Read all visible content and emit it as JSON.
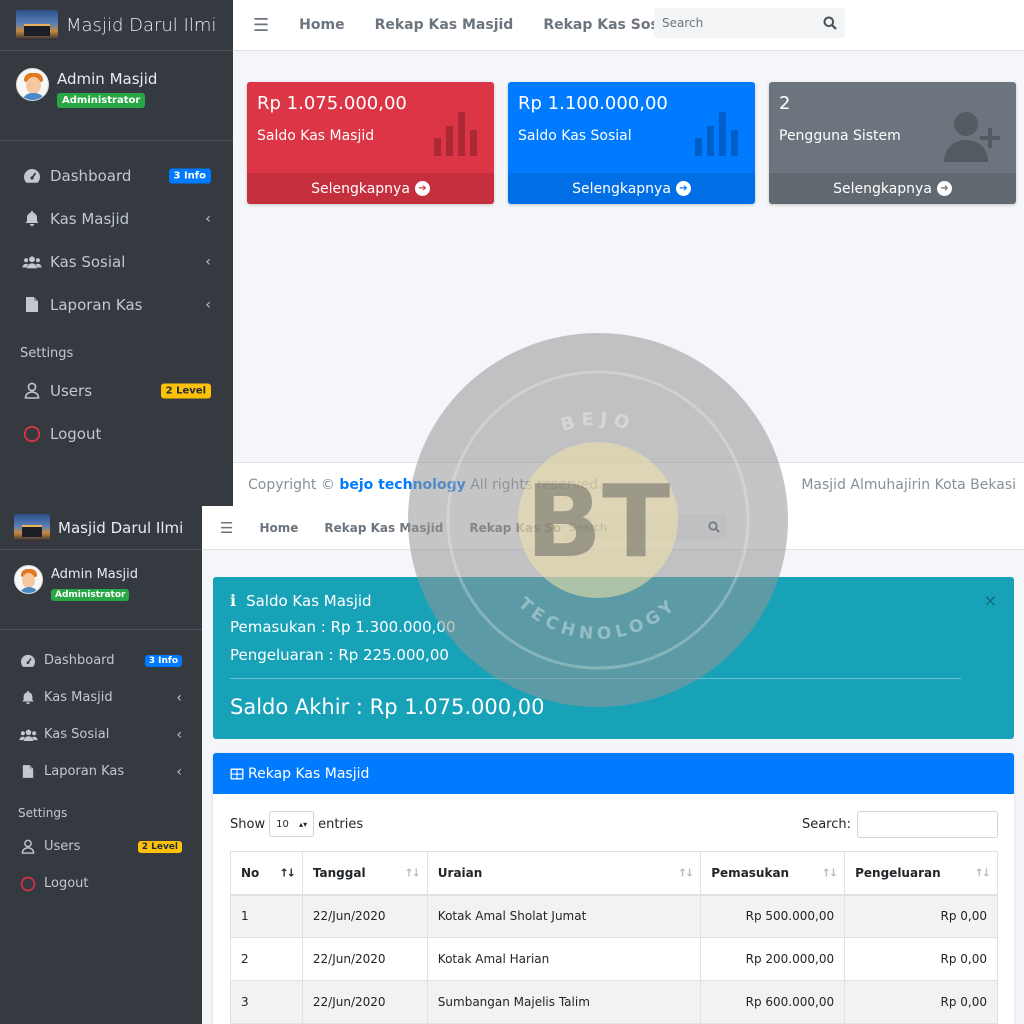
{
  "brand": {
    "name": "Masjid Darul Ilmi"
  },
  "user": {
    "name": "Admin Masjid",
    "role": "Administrator"
  },
  "sidebar": {
    "items": [
      {
        "label": "Dashboard",
        "badge": "3 Info"
      },
      {
        "label": "Kas Masjid"
      },
      {
        "label": "Kas Sosial"
      },
      {
        "label": "Laporan Kas"
      }
    ],
    "settings_header": "Settings",
    "settings": [
      {
        "label": "Users",
        "badge": "2 Level"
      },
      {
        "label": "Logout"
      }
    ]
  },
  "topnav": {
    "links": [
      "Home",
      "Rekap Kas Masjid",
      "Rekap Kas Sosial"
    ],
    "search_placeholder": "Search"
  },
  "dashboard": {
    "boxes": [
      {
        "value": "Rp 1.075.000,00",
        "label": "Saldo Kas Masjid",
        "more": "Selengkapnya",
        "color": "#dc3545"
      },
      {
        "value": "Rp 1.100.000,00",
        "label": "Saldo Kas Sosial",
        "more": "Selengkapnya",
        "color": "#007bff"
      },
      {
        "value": "2",
        "label": "Pengguna Sistem",
        "more": "Selengkapnya",
        "color": "#6c757d"
      }
    ]
  },
  "footer": {
    "copyright_prefix": "Copyright ©",
    "company": "bejo technology",
    "rights": "All rights reserved.",
    "right_text": "Masjid Almuhajirin Kota Bekasi"
  },
  "saldo_alert": {
    "title": "Saldo Kas Masjid",
    "pemasukan": "Pemasukan : Rp 1.300.000,00",
    "pengeluaran": "Pengeluaran : Rp 225.000,00",
    "saldo_akhir": "Saldo Akhir : Rp 1.075.000,00",
    "close": "×"
  },
  "rekap": {
    "title": "Rekap Kas Masjid",
    "show_label": "Show",
    "entries_label": "entries",
    "page_length": "10",
    "search_label": "Search:",
    "columns": [
      "No",
      "Tanggal",
      "Uraian",
      "Pemasukan",
      "Pengeluaran"
    ],
    "rows": [
      [
        "1",
        "22/Jun/2020",
        "Kotak Amal Sholat Jumat",
        "Rp 500.000,00",
        "Rp 0,00"
      ],
      [
        "2",
        "22/Jun/2020",
        "Kotak Amal Harian",
        "Rp 200.000,00",
        "Rp 0,00"
      ],
      [
        "3",
        "22/Jun/2020",
        "Sumbangan Majelis Talim",
        "Rp 600.000,00",
        "Rp 0,00"
      ]
    ]
  },
  "watermark": {
    "top_text": "BEJO",
    "bottom_text": "TECHNOLOGY",
    "monogram": "BT"
  }
}
